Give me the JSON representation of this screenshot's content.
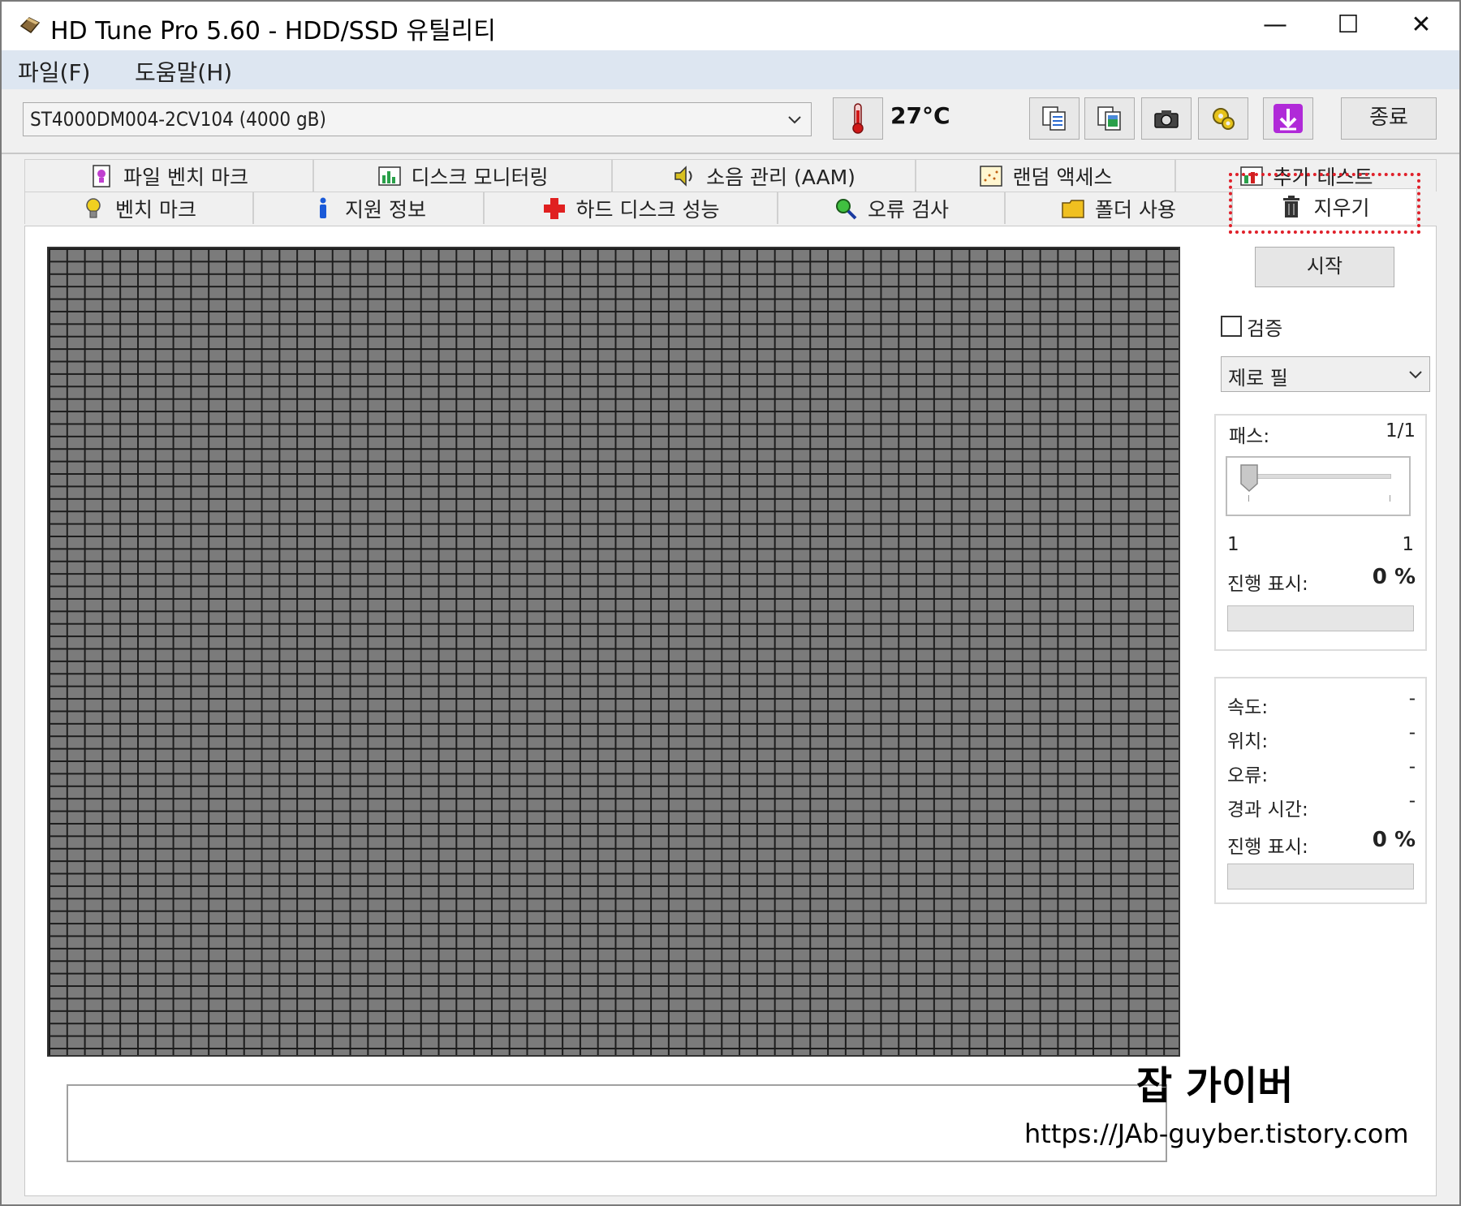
{
  "window": {
    "title": "HD Tune Pro 5.60 - HDD/SSD 유틸리티",
    "minimize": "—",
    "maximize": "☐",
    "close": "✕"
  },
  "menu": {
    "items": [
      "파일(F)",
      "도움말(H)"
    ]
  },
  "toolbar": {
    "drive": "ST4000DM004-2CV104 (4000 gB)",
    "temperature": "27°C",
    "exit_label": "종료",
    "icons": [
      "thermometer-icon",
      "copy-text-icon",
      "copy-screenshot-icon",
      "camera-icon",
      "options-icon",
      "download-icon"
    ]
  },
  "tabs": {
    "row1": [
      {
        "label": "파일 벤치 마크",
        "icon": "file-benchmark-icon"
      },
      {
        "label": "디스크 모니터링",
        "icon": "disk-monitor-icon"
      },
      {
        "label": "소음 관리 (AAM)",
        "icon": "speaker-icon"
      },
      {
        "label": "랜덤 액세스",
        "icon": "random-access-icon"
      },
      {
        "label": "추가 테스트",
        "icon": "extra-tests-icon"
      }
    ],
    "row2": [
      {
        "label": "벤치 마크",
        "icon": "lightbulb-icon"
      },
      {
        "label": "지원 정보",
        "icon": "info-icon"
      },
      {
        "label": "하드 디스크 성능",
        "icon": "health-cross-icon"
      },
      {
        "label": "오류 검사",
        "icon": "magnifier-icon"
      },
      {
        "label": "폴더 사용",
        "icon": "folder-icon"
      },
      {
        "label": "지우기",
        "icon": "trash-icon"
      }
    ],
    "active": "지우기"
  },
  "erase": {
    "start_label": "시작",
    "verify_label": "검증",
    "verify_checked": false,
    "method": "제로 필",
    "pass_label": "패스:",
    "pass_value": "1/1",
    "slider_min": "1",
    "slider_max": "1",
    "progress_label": "진행 표시:",
    "progress_value": "0 %",
    "progress_fraction": 0
  },
  "stats": {
    "speed_label": "속도:",
    "speed_value": "-",
    "position_label": "위치:",
    "position_value": "-",
    "errors_label": "오류:",
    "errors_value": "-",
    "elapsed_label": "경과 시간:",
    "elapsed_value": "-",
    "progress_label": "진행 표시:",
    "progress_value": "0 %",
    "progress_fraction": 0
  },
  "watermark": {
    "name": "잡 가이버",
    "url": "https://JAb-guyber.tistory.com"
  },
  "colors": {
    "menubar": "#dde6f1",
    "grid_block": "#7b7b7b",
    "grid_line": "#1c1c1c",
    "highlight": "#e0202a"
  }
}
